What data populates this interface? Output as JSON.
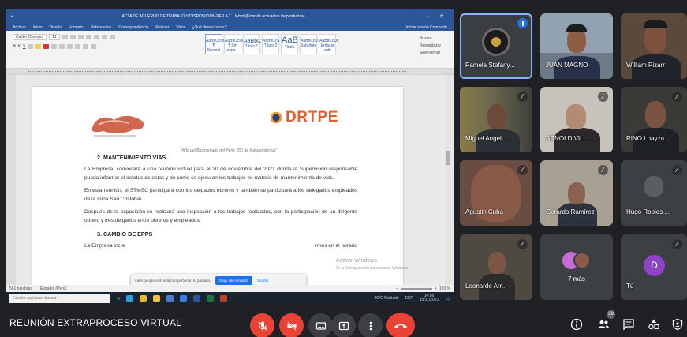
{
  "word": {
    "title": "ACTA DE ACUERDO DE TRABAJO Y DISPOSICION DE LA T... Word (Error de activacion de productos)",
    "menu": [
      "Archivo",
      "Inicio",
      "Diseño",
      "Formato",
      "Referencias",
      "Correspondencia",
      "Revisar",
      "Vista",
      "¿Qué desea hacer?"
    ],
    "menu_right": "Iniciar sesión  Compartir",
    "font_name": "Calibri (Cuerpo)",
    "font_size": "11",
    "styles": [
      {
        "sample": "AaBbCcDc",
        "label": "¶ Normal"
      },
      {
        "sample": "AaBbCcDc",
        "label": "¶ Sin espa..."
      },
      {
        "sample": "AaBbC",
        "label": "Título 1"
      },
      {
        "sample": "AaBbCcE",
        "label": "Título 2"
      },
      {
        "sample": "AaB",
        "label": "Título"
      },
      {
        "sample": "AaBbCcD",
        "label": "Subtítulo"
      },
      {
        "sample": "AaBbCcDc",
        "label": "Énfasis sutil"
      }
    ],
    "editing": [
      "Buscar",
      "Reemplazar",
      "Seleccionar"
    ],
    "logo_right": "DRTPE",
    "motto": "\"Año del Bicentenario del Perú: 200 de Independencia\"",
    "section2_title": "2.   MANTENIMIENTO  VIAS.",
    "p1": "La Empresa, convocará a una reunión virtual para el 20 de noviembre del 2021 donde la Supervisión responsable pueda informar el estatus de estas y de cómo se ejecutan los trabajos en materia de mantenimiento de vías.",
    "p2": "En esta reunión, el STMSC participará con los delgados obreros y también se participará a los delegados empleados de la mina San Cristóbal.",
    "p3": "Después de la exposición se realizará una inspección a los trabajos realizados, con la participación de un dirigente obrero y tres delgados entre obreros y empleados.",
    "section3_title": "3.   CAMBIO DE EPPS",
    "p4_start": "La Empresa incre",
    "p4_end": "rmes en el horario",
    "activate_title": "Activar Windows",
    "activate_sub": "Ve a Configuración para activar Windows.",
    "status_words": "561 palabras",
    "status_lang": "Español (Perú)",
    "zoom": "100 %",
    "search_placeholder": "Escribe aquí para buscar",
    "weather": "20°C  Nublado",
    "lang_tray": "ESP",
    "clock_time": "14:56",
    "clock_date": "15/11/2021"
  },
  "share_bar": {
    "text": "meet.google.com está compartiendo tu pantalla.",
    "stop_label": "Dejar de compartir",
    "hide_label": "Ocultar"
  },
  "participants": [
    {
      "name": "Pamela Stefany..."
    },
    {
      "name": "JUAN MAGNO"
    },
    {
      "name": "William Pizarr"
    },
    {
      "name": "Miguel Angel ..."
    },
    {
      "name": "ARNOLD VILL..."
    },
    {
      "name": "RINO Loayza"
    },
    {
      "name": "Agustin Cuba"
    },
    {
      "name": "Gerardo Ramírez"
    },
    {
      "name": "Hugo Robles ..."
    },
    {
      "name": "Leonardo Arr..."
    },
    {
      "name": "7 más"
    },
    {
      "name": "Tú",
      "initial": "D"
    }
  ],
  "meeting": {
    "title": "REUNIÓN EXTRAPROCESO VIRTUAL",
    "participant_count": "29"
  },
  "colors": {
    "meet_bg": "#202124",
    "mute_red": "#ea4335",
    "word_blue": "#2b579a",
    "you_avatar": "#8e44c8"
  },
  "icons": [
    "mic-off-icon",
    "camera-off-icon",
    "captions-icon",
    "present-icon",
    "more-options-icon",
    "hang-up-icon",
    "info-icon",
    "people-icon",
    "chat-icon",
    "activities-icon",
    "host-controls-icon"
  ]
}
